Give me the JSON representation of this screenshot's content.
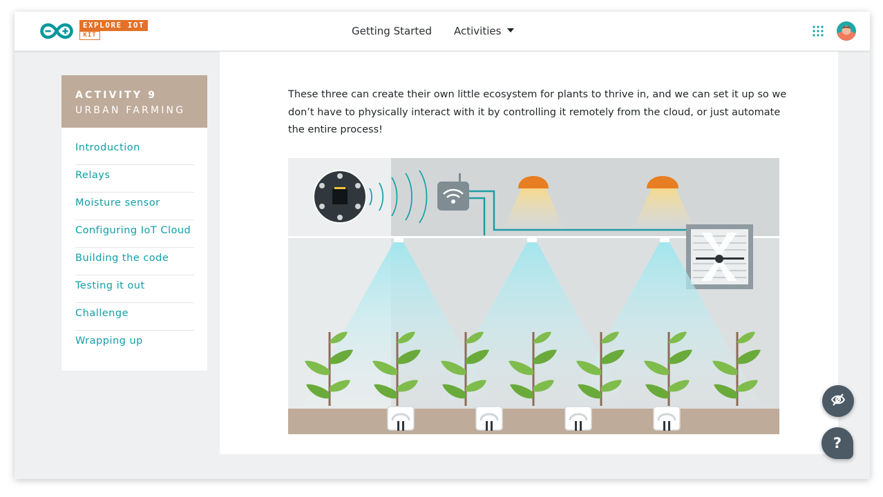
{
  "header": {
    "logo": {
      "badge_top": "EXPLORE IOT",
      "badge_bottom": "KIT",
      "brand_color": "#00979D",
      "badge_color": "#E47128"
    },
    "nav": {
      "getting_started": "Getting Started",
      "activities": "Activities"
    },
    "icons": {
      "apps": "grid-apps-icon",
      "avatar": "user-avatar",
      "activities_caret": "caret-down-icon"
    }
  },
  "sidebar": {
    "activity_number": "ACTIVITY 9",
    "activity_title": "URBAN FARMING",
    "header_color": "#BFAB9A",
    "link_color": "#0F9EA6",
    "items": [
      {
        "label": "Introduction"
      },
      {
        "label": "Relays"
      },
      {
        "label": "Moisture sensor"
      },
      {
        "label": "Configuring IoT Cloud"
      },
      {
        "label": "Building the code"
      },
      {
        "label": "Testing it out"
      },
      {
        "label": "Challenge"
      },
      {
        "label": "Wrapping up"
      }
    ]
  },
  "content": {
    "paragraph": "These three can create their own little ecosystem for plants to thrive in, and we can set it up so we don’t have to physically interact with it by controlling it remotely from the cloud, or just automate the entire process!"
  },
  "illustration": {
    "subject": "urban-farming-greenhouse",
    "elements": [
      "iot-board-icon",
      "wifi-signal-icon",
      "router-icon",
      "grow-lamp-icon",
      "grow-lamp-icon",
      "fan-icon",
      "water-sprinkler",
      "plant",
      "moisture-sensor"
    ]
  },
  "floating_buttons": {
    "hide_icon": "eye-off-icon",
    "help_label": "?",
    "color": "#4C5A66"
  }
}
